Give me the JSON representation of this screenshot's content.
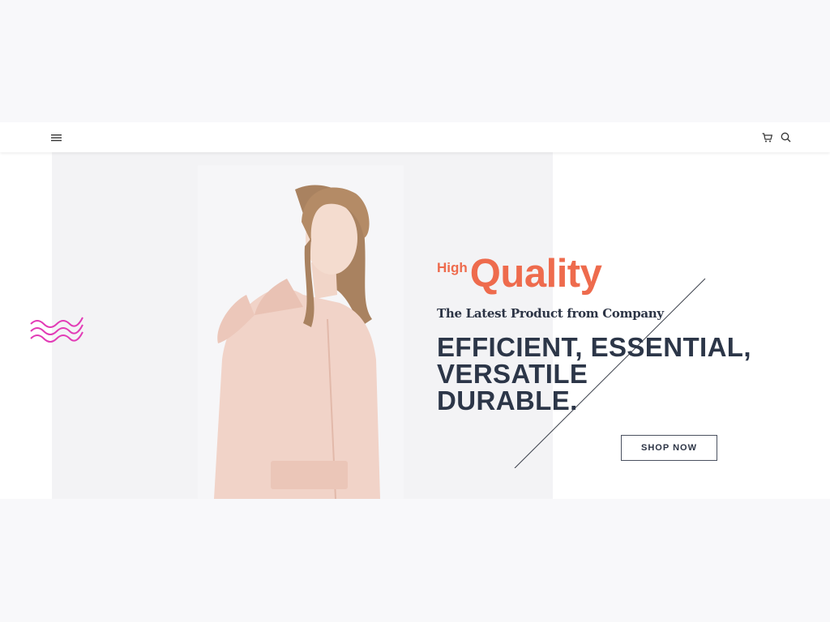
{
  "nav": {
    "icons": {
      "menu": "hamburger-menu-icon",
      "cart": "shopping-cart-icon",
      "search": "search-icon"
    }
  },
  "hero": {
    "eyebrow_small": "High",
    "eyebrow_large": "Quality",
    "tagline": "The Latest Product from Company",
    "headline_lines": [
      "EFFICIENT, ESSENTIAL,",
      "VERSATILE",
      "DURABLE."
    ],
    "cta_label": "SHOP NOW",
    "image_alt": "woman-in-pink-raincoat"
  },
  "colors": {
    "accent": "#ee6b4d",
    "headline": "#2c3648",
    "squiggle": "#e23bb6",
    "page_bg": "#f8f8fa"
  }
}
